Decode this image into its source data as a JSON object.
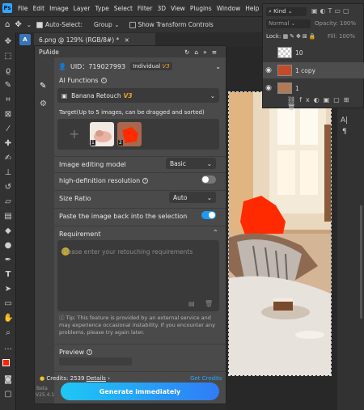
{
  "menu": {
    "logo": "Ps",
    "items": [
      "File",
      "Edit",
      "Image",
      "Layer",
      "Type",
      "Select",
      "Filter",
      "3D",
      "View",
      "Plugins",
      "Window",
      "Help"
    ]
  },
  "options_bar": {
    "auto_select_label": "Auto-Select:",
    "group_value": "Group",
    "transform_label": "Show Transform Controls"
  },
  "document": {
    "tab_title": "6.png @ 129% (RGB/8#) *"
  },
  "layers": {
    "kind_label": "Kind",
    "blend_mode": "Normal",
    "opacity_label": "Opacity:",
    "opacity_value": "100%",
    "lock_label": "Lock:",
    "fill_label": "Fill:",
    "fill_value": "100%",
    "items": [
      "10",
      "1 copy",
      "1"
    ]
  },
  "psaide": {
    "title": "PsAide",
    "uid": "UID：719027993",
    "plan": "Individual",
    "plan_badge": "V3",
    "ai_functions_label": "AI Functions",
    "function_selected": "Banana Retouch",
    "function_badge": "V3",
    "target_label": "Target(Up to 5 images, can be dragged and sorted)",
    "target_add": "+",
    "target_nums": [
      "1",
      "2"
    ],
    "model_label": "Image editing model",
    "model_value": "Basic",
    "hd_label": "high-definition resolution",
    "ratio_label": "Size Ratio",
    "ratio_value": "Auto",
    "paste_label": "Paste the image back into the selection",
    "requirement_label": "Requirement",
    "requirement_placeholder": "Please enter your retouching requirements",
    "tip": "Tip: This feature is provided by an external service and may experience occasional instability. If you encounter any problems, please try again later.",
    "preview_label": "Preview",
    "credits": "Credits: 2539",
    "details": "Details",
    "get_credits": "Get Credits",
    "generate_button": "Generate immediately",
    "beta_label": "Beta",
    "version": "V25.4.1"
  }
}
